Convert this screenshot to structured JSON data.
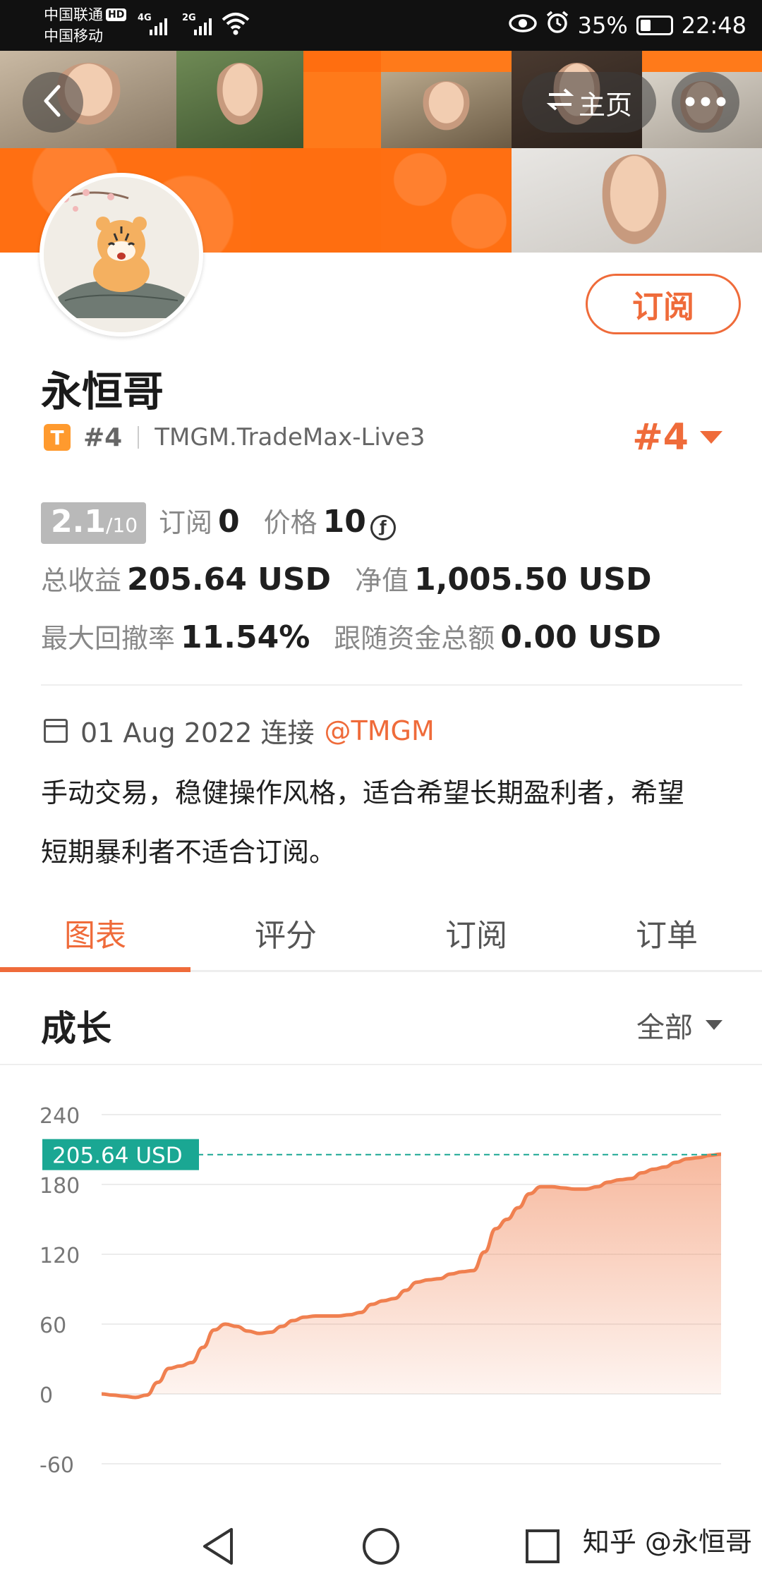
{
  "status_bar": {
    "carrier1": "中国联通",
    "carrier1_badge": "HD",
    "carrier2": "中国移动",
    "net1": "4G",
    "net2": "2G",
    "battery": "35%",
    "time": "22:48"
  },
  "header": {
    "home_label": "主页"
  },
  "profile": {
    "name": "永恒哥",
    "badge_letter": "T",
    "rank_small": "#4",
    "server": "TMGM.TradeMax-Live3",
    "rank_big": "#4",
    "subscribe_label": "订阅"
  },
  "stats": {
    "score_main": "2.1",
    "score_sub": "/10",
    "subs_label": "订阅",
    "subs_value": "0",
    "price_label": "价格",
    "price_value": "10",
    "coin_symbol": "ƒ",
    "profit_label": "总收益",
    "profit_value": "205.64 USD",
    "equity_label": "净值",
    "equity_value": "1,005.50 USD",
    "drawdown_label": "最大回撤率",
    "drawdown_value": "11.54%",
    "follow_label": "跟随资金总额",
    "follow_value": "0.00 USD"
  },
  "info": {
    "date_text": "01 Aug 2022 连接",
    "mention": "@TMGM",
    "desc_line1": "手动交易，稳健操作风格，适合希望长期盈利者，希望",
    "desc_line2": "短期暴利者不适合订阅。"
  },
  "tabs": [
    {
      "label": "图表",
      "active": true
    },
    {
      "label": "评分",
      "active": false
    },
    {
      "label": "订阅",
      "active": false
    },
    {
      "label": "订单",
      "active": false
    }
  ],
  "section": {
    "title": "成长",
    "filter_label": "全部"
  },
  "chart_data": {
    "type": "area",
    "title": "",
    "xlabel": "",
    "ylabel": "",
    "ylim": [
      -60,
      240
    ],
    "yticks": [
      "240",
      "180",
      "120",
      "60",
      "0",
      "-60"
    ],
    "current_label": "205.64 USD",
    "current_value": 205.64,
    "color": "#f08050",
    "grid": true,
    "series": [
      {
        "values": [
          0,
          -1,
          -2,
          -3,
          -1,
          10,
          22,
          24,
          27,
          40,
          55,
          60,
          58,
          54,
          52,
          53,
          58,
          63,
          66,
          67,
          67,
          67,
          68,
          70,
          77,
          80,
          82,
          89,
          96,
          98,
          99,
          103,
          105,
          106,
          122,
          142,
          150,
          160,
          172,
          178,
          178,
          177,
          176,
          176,
          178,
          182,
          184,
          185,
          190,
          193,
          195,
          199,
          202,
          203,
          205,
          206
        ]
      }
    ]
  },
  "footer": {
    "watermark": "知乎 @永恒哥"
  },
  "colors": {
    "accent": "#ef6b3a",
    "teal": "#1aa793"
  }
}
